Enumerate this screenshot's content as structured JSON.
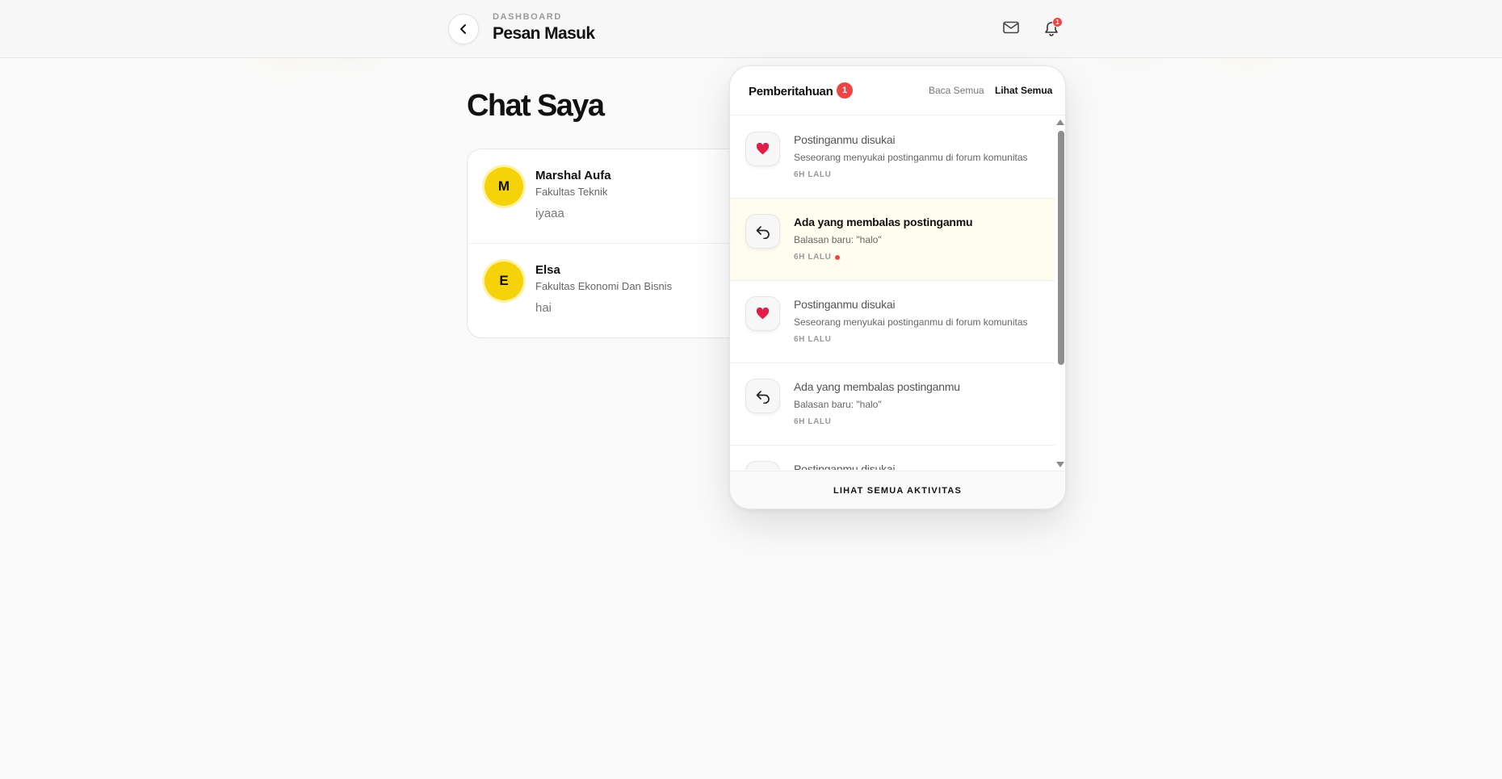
{
  "header": {
    "breadcrumb": "DASHBOARD",
    "title": "Pesan Masuk",
    "back_icon": "chevron-left-icon",
    "mail_icon": "mail-icon",
    "bell_icon": "bell-icon",
    "bell_badge": "1"
  },
  "main": {
    "heading": "Chat Saya",
    "chats": [
      {
        "initial": "M",
        "name": "Marshal Aufa",
        "faculty": "Fakultas Teknik",
        "last_message": "iyaaa"
      },
      {
        "initial": "E",
        "name": "Elsa",
        "faculty": "Fakultas Ekonomi Dan Bisnis",
        "last_message": "hai"
      }
    ]
  },
  "notifications": {
    "title": "Pemberitahuan",
    "count": "1",
    "read_all_label": "Baca Semua",
    "see_all_label": "Lihat Semua",
    "footer_label": "LIHAT SEMUA AKTIVITAS",
    "items": [
      {
        "icon": "heart-icon",
        "title": "Postinganmu disukai",
        "desc": "Seseorang menyukai postinganmu di forum komunitas",
        "time": "6H LALU",
        "unread": false
      },
      {
        "icon": "reply-icon",
        "title": "Ada yang membalas postinganmu",
        "desc": "Balasan baru: \"halo\"",
        "time": "6H LALU",
        "unread": true
      },
      {
        "icon": "heart-icon",
        "title": "Postinganmu disukai",
        "desc": "Seseorang menyukai postinganmu di forum komunitas",
        "time": "6H LALU",
        "unread": false
      },
      {
        "icon": "reply-icon",
        "title": "Ada yang membalas postinganmu",
        "desc": "Balasan baru: \"halo\"",
        "time": "6H LALU",
        "unread": false
      },
      {
        "icon": "heart-icon",
        "title": "Postinganmu disukai",
        "desc": "",
        "time": "",
        "unread": false
      }
    ]
  },
  "colors": {
    "accent_yellow": "#f5d20a",
    "badge_red": "#ef4444",
    "heart_red": "#e11d48",
    "unread_bg": "#fffdf0"
  }
}
